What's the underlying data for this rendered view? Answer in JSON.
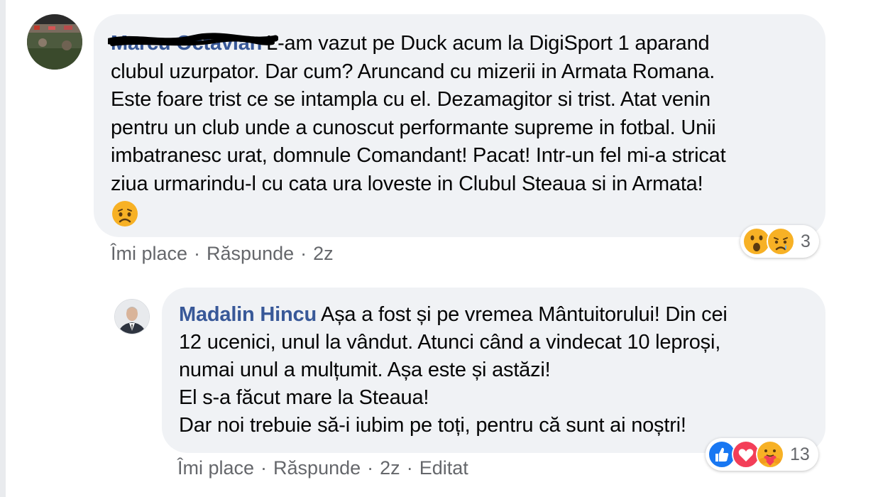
{
  "comment1": {
    "author": "Marcu Octavian",
    "lines": [
      "L-am vazut pe Duck acum la DigiSport 1 aparand",
      "clubul uzurpator. Dar cum? Aruncand cu mizerii in Armata Romana.",
      "Este foare trist ce se intampla cu el. Dezamagitor si trist. Atat venin",
      "pentru un club unde a cunoscut performante supreme in fotbal. Unii",
      "imbatranesc urat, domnule Comandant! Pacat! Intr-un fel mi-a stricat",
      "ziua urmarindu-l cu cata ura loveste in Clubul Steaua si in Armata!"
    ],
    "trailing_emoji": "sad-face",
    "reactions": {
      "icons": [
        "wow",
        "sad"
      ],
      "count": "3"
    },
    "actions": {
      "like": "Îmi place",
      "reply": "Răspunde",
      "time": "2z"
    }
  },
  "comment2": {
    "author": "Madalin Hincu",
    "lines": [
      "Așa a fost și pe vremea Mântuitorului! Din cei",
      "12 ucenici, unul la vândut. Atunci când a vindecat 10 leproși,",
      "numai unul a mulțumit. Așa este și astăzi!",
      "El s-a făcut mare la Steaua!",
      "Dar noi trebuie să-i iubim pe toți, pentru că sunt ai noștri!"
    ],
    "reactions": {
      "icons": [
        "like",
        "love",
        "care"
      ],
      "count": "13"
    },
    "actions": {
      "like": "Îmi place",
      "reply": "Răspunde",
      "time": "2z",
      "edited": "Editat"
    }
  },
  "separator": "·",
  "colors": {
    "bubble": "#f0f2f5",
    "author": "#385898",
    "meta": "#65676b",
    "like": "#1877f2",
    "love": "#f33e58",
    "emoji": "#f7b125"
  }
}
